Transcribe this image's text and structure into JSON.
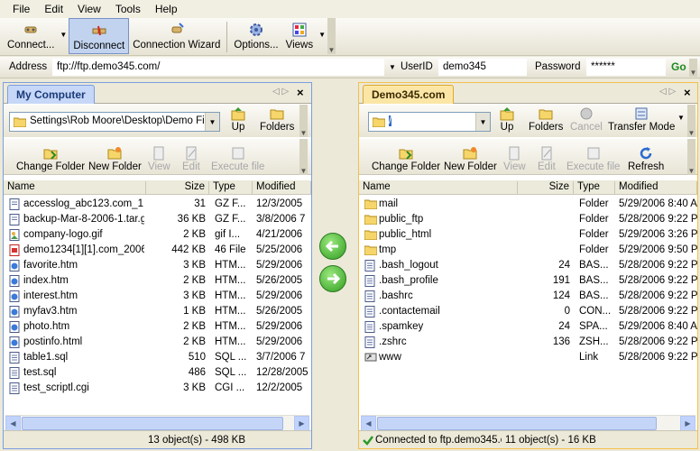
{
  "menu": [
    "File",
    "Edit",
    "View",
    "Tools",
    "Help"
  ],
  "toolbar": {
    "connect": "Connect...",
    "disconnect": "Disconnect",
    "wizard": "Connection Wizard",
    "options": "Options...",
    "views": "Views"
  },
  "address_bar": {
    "address_label": "Address",
    "address_value": "ftp://ftp.demo345.com/",
    "userid_label": "UserID",
    "userid_value": "demo345",
    "password_label": "Password",
    "password_value": "******",
    "go_label": "Go"
  },
  "left_pane": {
    "tab": "My Computer",
    "path": "Settings\\Rob Moore\\Desktop\\Demo Files",
    "buttons": {
      "up": "Up",
      "folders": "Folders",
      "change_folder": "Change Folder",
      "new_folder": "New Folder",
      "view": "View",
      "edit": "Edit",
      "execute": "Execute file"
    },
    "columns": [
      "Name",
      "Size",
      "Type",
      "Modified"
    ],
    "files": [
      {
        "name": "accesslog_abc123.com_1...",
        "size": "31",
        "type": "GZ F...",
        "modified": "12/3/2005",
        "icon": "archive"
      },
      {
        "name": "backup-Mar-8-2006-1.tar.gz",
        "size": "36 KB",
        "type": "GZ F...",
        "modified": "3/8/2006 7",
        "icon": "archive"
      },
      {
        "name": "company-logo.gif",
        "size": "2 KB",
        "type": "gif I...",
        "modified": "4/21/2006",
        "icon": "image"
      },
      {
        "name": "demo1234[1][1].com_2006...",
        "size": "442 KB",
        "type": "46 File",
        "modified": "5/25/2006",
        "icon": "doc-red"
      },
      {
        "name": "favorite.htm",
        "size": "3 KB",
        "type": "HTM...",
        "modified": "5/29/2006",
        "icon": "html"
      },
      {
        "name": "index.htm",
        "size": "2 KB",
        "type": "HTM...",
        "modified": "5/26/2005",
        "icon": "html"
      },
      {
        "name": "interest.htm",
        "size": "3 KB",
        "type": "HTM...",
        "modified": "5/29/2006",
        "icon": "html"
      },
      {
        "name": "myfav3.htm",
        "size": "1 KB",
        "type": "HTM...",
        "modified": "5/26/2005",
        "icon": "html"
      },
      {
        "name": "photo.htm",
        "size": "2 KB",
        "type": "HTM...",
        "modified": "5/29/2006",
        "icon": "html"
      },
      {
        "name": "postinfo.html",
        "size": "2 KB",
        "type": "HTM...",
        "modified": "5/29/2006",
        "icon": "html"
      },
      {
        "name": "table1.sql",
        "size": "510",
        "type": "SQL ...",
        "modified": "3/7/2006 7",
        "icon": "doc"
      },
      {
        "name": "test.sql",
        "size": "486",
        "type": "SQL ...",
        "modified": "12/28/2005",
        "icon": "doc"
      },
      {
        "name": "test_scriptl.cgi",
        "size": "3 KB",
        "type": "CGI ...",
        "modified": "12/2/2005",
        "icon": "doc"
      }
    ],
    "status": "13 object(s) - 498 KB"
  },
  "right_pane": {
    "tab": "Demo345.com",
    "path": "/",
    "buttons": {
      "up": "Up",
      "folders": "Folders",
      "cancel": "Cancel",
      "transfer_mode": "Transfer Mode",
      "change_folder": "Change Folder",
      "new_folder": "New Folder",
      "view": "View",
      "edit": "Edit",
      "execute": "Execute file",
      "refresh": "Refresh"
    },
    "columns": [
      "Name",
      "Size",
      "Type",
      "Modified"
    ],
    "files": [
      {
        "name": "mail",
        "size": "",
        "type": "Folder",
        "modified": "5/29/2006 8:40 A",
        "icon": "folder"
      },
      {
        "name": "public_ftp",
        "size": "",
        "type": "Folder",
        "modified": "5/28/2006 9:22 P",
        "icon": "folder"
      },
      {
        "name": "public_html",
        "size": "",
        "type": "Folder",
        "modified": "5/29/2006 3:26 P",
        "icon": "folder"
      },
      {
        "name": "tmp",
        "size": "",
        "type": "Folder",
        "modified": "5/29/2006 9:50 P",
        "icon": "folder"
      },
      {
        "name": ".bash_logout",
        "size": "24",
        "type": "BAS...",
        "modified": "5/28/2006 9:22 P",
        "icon": "doc"
      },
      {
        "name": ".bash_profile",
        "size": "191",
        "type": "BAS...",
        "modified": "5/28/2006 9:22 P",
        "icon": "doc"
      },
      {
        "name": ".bashrc",
        "size": "124",
        "type": "BAS...",
        "modified": "5/28/2006 9:22 P",
        "icon": "doc"
      },
      {
        "name": ".contactemail",
        "size": "0",
        "type": "CON...",
        "modified": "5/28/2006 9:22 P",
        "icon": "doc"
      },
      {
        "name": ".spamkey",
        "size": "24",
        "type": "SPA...",
        "modified": "5/29/2006 8:40 A",
        "icon": "doc"
      },
      {
        "name": ".zshrc",
        "size": "136",
        "type": "ZSH...",
        "modified": "5/28/2006 9:22 P",
        "icon": "doc"
      },
      {
        "name": "www",
        "size": "",
        "type": "Link",
        "modified": "5/28/2006 9:22 P",
        "icon": "link"
      }
    ],
    "status_connection": "Connected to ftp.demo345.c",
    "status": "11 object(s) - 16 KB"
  },
  "colors": {
    "left_accent": "#7b9ee0",
    "right_accent": "#f5c04a",
    "transfer_green": "#2f9d20"
  }
}
